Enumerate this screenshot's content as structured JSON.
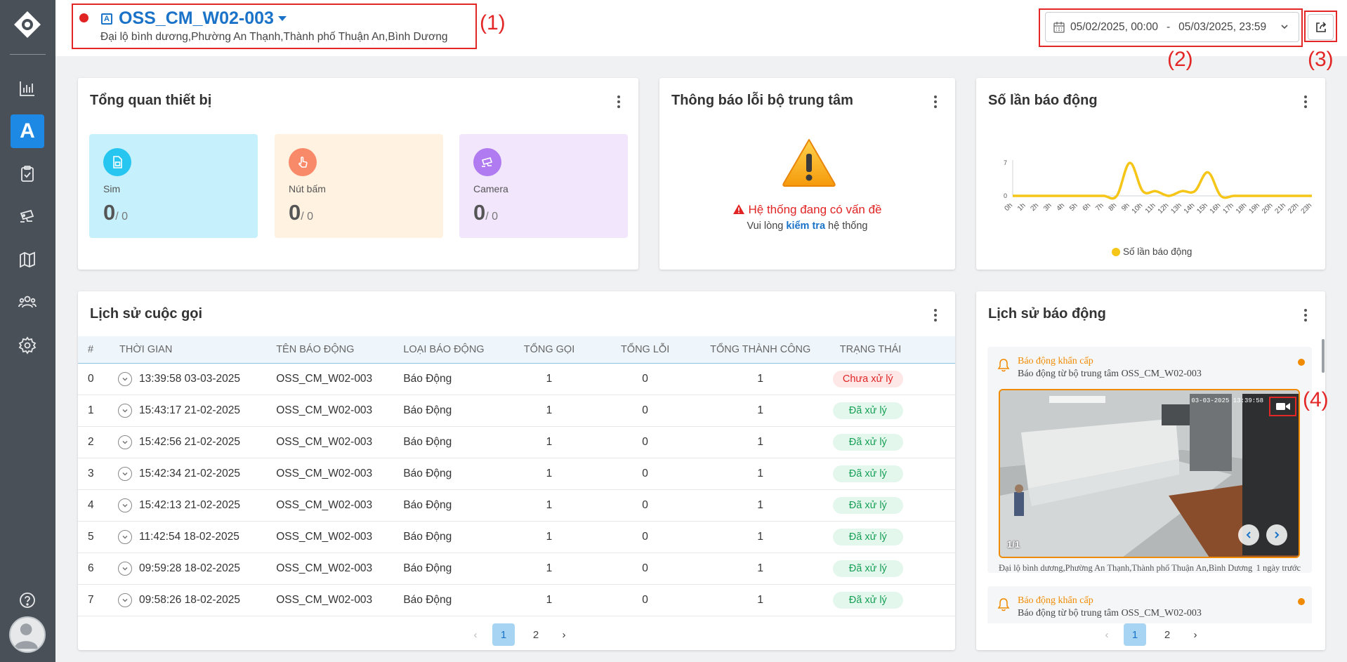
{
  "header": {
    "device_name": "OSS_CM_W02-003",
    "device_type_letter": "A",
    "address": "Đại lộ bình dương,Phường An Thạnh,Thành phố Thuận An,Bình Dương",
    "date_start": "05/02/2025, 00:00",
    "date_sep": "-",
    "date_end": "05/03/2025, 23:59",
    "status_color": "#e02424"
  },
  "annotations": [
    "(1)",
    "(2)",
    "(3)",
    "(4)"
  ],
  "sidebar": {
    "items": [
      {
        "icon": "bar-chart-icon"
      },
      {
        "icon": "letter-a-icon",
        "label": "A",
        "active": true
      },
      {
        "icon": "clipboard-check-icon"
      },
      {
        "icon": "cctv-camera-icon"
      },
      {
        "icon": "map-icon"
      },
      {
        "icon": "users-icon"
      },
      {
        "icon": "settings-icon"
      }
    ],
    "help_icon": "help-circle-icon"
  },
  "overview": {
    "title": "Tổng quan thiết bị",
    "stats": [
      {
        "label": "Sim",
        "value": "0",
        "total": "/ 0",
        "color": "#26c6f0",
        "bg": "#c6f1fc"
      },
      {
        "label": "Nút bấm",
        "value": "0",
        "total": "/ 0",
        "color": "#f88a6a",
        "bg": "#fff2e0"
      },
      {
        "label": "Camera",
        "value": "0",
        "total": "/ 0",
        "color": "#b07af0",
        "bg": "#f2e6fd"
      }
    ]
  },
  "center_error": {
    "title": "Thông báo lỗi bộ trung tâm",
    "message": "Hệ thống đang có vấn đề",
    "hint_prefix": "Vui lòng",
    "hint_link": "kiểm tra",
    "hint_suffix": "hệ thống"
  },
  "alarm_count": {
    "title": "Số lần báo động",
    "legend": "Số lần báo động"
  },
  "chart_data": {
    "type": "line",
    "categories": [
      "0h",
      "1h",
      "2h",
      "3h",
      "4h",
      "5h",
      "6h",
      "7h",
      "8h",
      "9h",
      "10h",
      "11h",
      "12h",
      "13h",
      "14h",
      "15h",
      "16h",
      "17h",
      "18h",
      "19h",
      "20h",
      "21h",
      "22h",
      "23h"
    ],
    "series": [
      {
        "name": "Số lần báo động",
        "values": [
          0,
          0,
          0,
          0,
          0,
          0,
          0,
          0,
          0,
          7,
          1,
          1,
          0,
          1,
          1,
          5,
          0,
          0,
          0,
          0,
          0,
          0,
          0,
          0
        ]
      }
    ],
    "yticks": [
      0,
      7
    ],
    "ylim": [
      0,
      7
    ],
    "color": "#f5c518",
    "legend_position": "bottom"
  },
  "call_history": {
    "title": "Lịch sử cuộc gọi",
    "columns": [
      "#",
      "THỜI GIAN",
      "TÊN BÁO ĐỘNG",
      "LOẠI BÁO ĐỘNG",
      "TỔNG GỌI",
      "TỔNG LỖI",
      "TỔNG THÀNH CÔNG",
      "TRẠNG THÁI"
    ],
    "rows": [
      {
        "idx": "0",
        "time": "13:39:58 03-03-2025",
        "name": "OSS_CM_W02-003",
        "type": "Báo Động",
        "calls": "1",
        "errors": "0",
        "success": "1",
        "status": "Chưa xử lý",
        "state": "pending"
      },
      {
        "idx": "1",
        "time": "15:43:17 21-02-2025",
        "name": "OSS_CM_W02-003",
        "type": "Báo Động",
        "calls": "1",
        "errors": "0",
        "success": "1",
        "status": "Đã xử lý",
        "state": "done"
      },
      {
        "idx": "2",
        "time": "15:42:56 21-02-2025",
        "name": "OSS_CM_W02-003",
        "type": "Báo Động",
        "calls": "1",
        "errors": "0",
        "success": "1",
        "status": "Đã xử lý",
        "state": "done"
      },
      {
        "idx": "3",
        "time": "15:42:34 21-02-2025",
        "name": "OSS_CM_W02-003",
        "type": "Báo Động",
        "calls": "1",
        "errors": "0",
        "success": "1",
        "status": "Đã xử lý",
        "state": "done"
      },
      {
        "idx": "4",
        "time": "15:42:13 21-02-2025",
        "name": "OSS_CM_W02-003",
        "type": "Báo Động",
        "calls": "1",
        "errors": "0",
        "success": "1",
        "status": "Đã xử lý",
        "state": "done"
      },
      {
        "idx": "5",
        "time": "11:42:54 18-02-2025",
        "name": "OSS_CM_W02-003",
        "type": "Báo Động",
        "calls": "1",
        "errors": "0",
        "success": "1",
        "status": "Đã xử lý",
        "state": "done"
      },
      {
        "idx": "6",
        "time": "09:59:28 18-02-2025",
        "name": "OSS_CM_W02-003",
        "type": "Báo Động",
        "calls": "1",
        "errors": "0",
        "success": "1",
        "status": "Đã xử lý",
        "state": "done"
      },
      {
        "idx": "7",
        "time": "09:58:26 18-02-2025",
        "name": "OSS_CM_W02-003",
        "type": "Báo Động",
        "calls": "1",
        "errors": "0",
        "success": "1",
        "status": "Đã xử lý",
        "state": "done"
      }
    ],
    "pages": [
      "1",
      "2"
    ],
    "current_page": "1"
  },
  "alarm_history": {
    "title": "Lịch sử báo động",
    "items": [
      {
        "type": "Báo động khẩn cấp",
        "desc": "Báo động từ bộ trung tâm OSS_CM_W02-003",
        "snapshot_time": "03-03-2025 13:39:58",
        "counter": "1/1",
        "address": "Đại lộ bình dương,Phường An Thạnh,Thành phố Thuận An,Bình Dương",
        "ago": "1 ngày trước"
      },
      {
        "type": "Báo động khẩn cấp",
        "desc": "Báo động từ bộ trung tâm OSS_CM_W02-003"
      }
    ],
    "pages": [
      "1",
      "2"
    ],
    "current_page": "1"
  }
}
